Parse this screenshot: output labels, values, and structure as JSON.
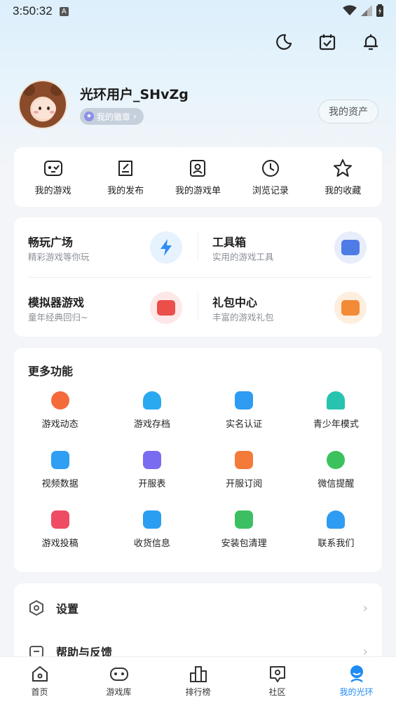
{
  "status": {
    "time": "3:50:32",
    "notification_glyph": "A"
  },
  "header": {
    "actions": [
      {
        "name": "dark-mode-icon"
      },
      {
        "name": "calendar-check-icon"
      },
      {
        "name": "bell-icon"
      }
    ]
  },
  "profile": {
    "username": "光环用户_SHvZg",
    "badge_label": "我的徽章",
    "badge_chevron": "›",
    "assets_label": "我的资产"
  },
  "quick_actions": [
    {
      "label": "我的游戏",
      "icon": "gamepad-icon"
    },
    {
      "label": "我的发布",
      "icon": "edit-icon"
    },
    {
      "label": "我的游戏单",
      "icon": "game-list-icon"
    },
    {
      "label": "浏览记录",
      "icon": "clock-icon"
    },
    {
      "label": "我的收藏",
      "icon": "star-icon"
    }
  ],
  "features": [
    {
      "title": "畅玩广场",
      "subtitle": "精彩游戏等你玩",
      "icon": "lightning-icon",
      "color": "#2f8cf3",
      "bg": "#e6f2fd"
    },
    {
      "title": "工具箱",
      "subtitle": "实用的游戏工具",
      "icon": "toolbox-icon",
      "color": "#4e7be6",
      "bg": "#e7edfb"
    },
    {
      "title": "模拟器游戏",
      "subtitle": "童年经典回归~",
      "icon": "emulator-icon",
      "color": "#ea4f4a",
      "bg": "#fde8e7"
    },
    {
      "title": "礼包中心",
      "subtitle": "丰富的游戏礼包",
      "icon": "gift-icon",
      "color": "#f28a36",
      "bg": "#fdeedd"
    }
  ],
  "more": {
    "title": "更多功能",
    "items": [
      {
        "label": "游戏动态",
        "icon": "game-news-icon",
        "color": "#f46a3a"
      },
      {
        "label": "游戏存档",
        "icon": "cloud-save-icon",
        "color": "#2aa9f0"
      },
      {
        "label": "实名认证",
        "icon": "id-card-icon",
        "color": "#2d9cf2"
      },
      {
        "label": "青少年模式",
        "icon": "umbrella-icon",
        "color": "#27c3b0"
      },
      {
        "label": "视频数据",
        "icon": "video-stats-icon",
        "color": "#2f9ff3"
      },
      {
        "label": "开服表",
        "icon": "server-table-icon",
        "color": "#7a6cf0"
      },
      {
        "label": "开服订阅",
        "icon": "subscribe-calendar-icon",
        "color": "#f47a3a"
      },
      {
        "label": "微信提醒",
        "icon": "wechat-icon",
        "color": "#3cc25c"
      },
      {
        "label": "游戏投稿",
        "icon": "submit-game-icon",
        "color": "#ef4b63"
      },
      {
        "label": "收货信息",
        "icon": "address-box-icon",
        "color": "#2a9ef0"
      },
      {
        "label": "安装包清理",
        "icon": "package-clean-icon",
        "color": "#3cbf63"
      },
      {
        "label": "联系我们",
        "icon": "customer-service-icon",
        "color": "#2f9cf2"
      }
    ]
  },
  "settings": [
    {
      "label": "设置",
      "icon": "settings-hex-icon",
      "chevron": "›"
    },
    {
      "label": "帮助与反馈",
      "icon": "help-icon",
      "chevron": "›"
    }
  ],
  "tabs": [
    {
      "label": "首页",
      "icon": "home-icon",
      "active": false
    },
    {
      "label": "游戏库",
      "icon": "game-library-icon",
      "active": false
    },
    {
      "label": "排行榜",
      "icon": "ranking-icon",
      "active": false
    },
    {
      "label": "社区",
      "icon": "community-icon",
      "active": false
    },
    {
      "label": "我的光环",
      "icon": "profile-icon",
      "active": true
    }
  ],
  "colors": {
    "accent": "#1f8bf5",
    "background": "#f3f5f8",
    "card": "#ffffff"
  }
}
